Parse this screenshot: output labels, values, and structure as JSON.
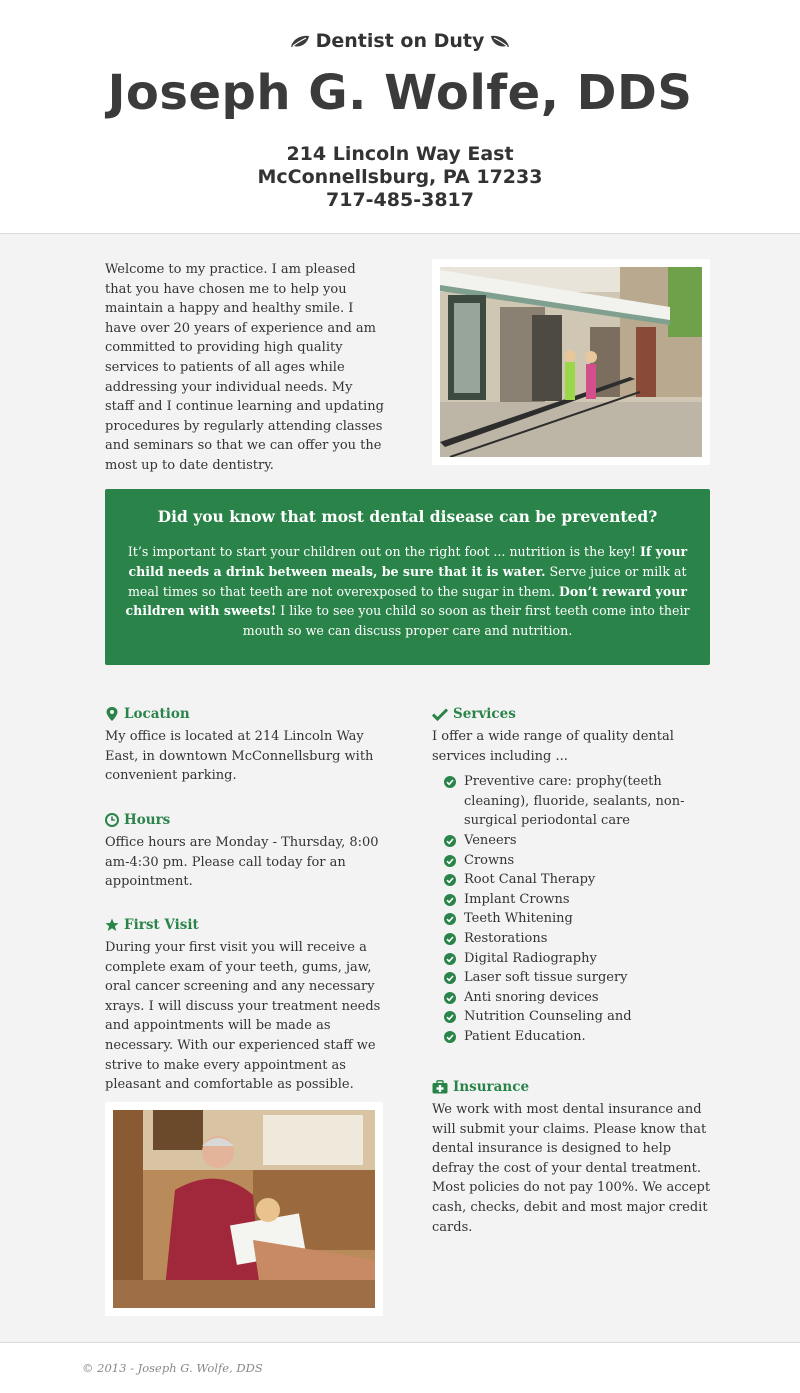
{
  "header": {
    "tagline": "Dentist on Duty",
    "name": "Joseph G. Wolfe, DDS",
    "address_line1": "214 Lincoln Way East",
    "address_line2": "McConnellsburg, PA 17233",
    "phone": "717-485-3817",
    "leaf_icon": "leaf-icon"
  },
  "welcome": {
    "text": "Welcome to my practice. I am pleased that you have chosen me to help you maintain a happy and healthy smile. I have over 20 years of experience and am committed to providing high quality services to patients of all ages while addressing your individual needs. My staff and I continue learning and updating procedures by regularly attending classes and seminars so that we can offer you the most up to date dentistry."
  },
  "callout": {
    "heading": "Did you know that most dental disease can be prevented?",
    "p1": "It’s important to start your children out on the right foot ... nutrition is the key! ",
    "b1": "If your child needs a drink between meals, be sure that it is water.",
    "p2": " Serve juice or milk at meal times so that teeth are not overexposed to the sugar in them. ",
    "b2": "Don’t reward your children with sweets!",
    "p3": " I like to see you child so soon as their first teeth come into their mouth so we can discuss proper care and nutrition.",
    "background_color": "#2a844a"
  },
  "location": {
    "title": "Location",
    "icon": "map-marker-icon",
    "text": "My office is located at 214 Lincoln Way East, in downtown McConnellsburg with convenient parking."
  },
  "hours": {
    "title": "Hours",
    "icon": "clock-icon",
    "text": "Office hours are Monday - Thursday, 8:00 am-4:30 pm. Please call today for an appointment."
  },
  "first_visit": {
    "title": "First Visit",
    "icon": "star-icon",
    "text": "During your first visit you will receive a complete exam of your teeth, gums, jaw, oral cancer screening and any necessary xrays. I will discuss your treatment needs and appointments will be made as necessary. With our experienced staff we strive to make every appointment as pleasant and comfortable as possible."
  },
  "services": {
    "title": "Services",
    "icon": "check-icon",
    "intro": "I offer a wide range of quality dental services including ...",
    "items": [
      "Preventive care: prophy(teeth cleaning), fluoride, sealants, non-surgical periodontal care",
      "Veneers",
      "Crowns",
      "Root Canal Therapy",
      "Implant Crowns",
      "Teeth Whitening",
      "Restorations",
      "Digital Radiography",
      "Laser soft tissue surgery",
      "Anti snoring devices",
      "Nutrition Counseling and",
      "Patient Education."
    ]
  },
  "insurance": {
    "title": "Insurance",
    "icon": "medkit-icon",
    "text": "We work with most dental insurance and will submit your claims. Please know that dental insurance is designed to help defray the cost of your dental treatment. Most policies do not pay 100%. We accept cash, checks, debit and most major credit cards."
  },
  "footer": {
    "copyright": "© 2013 - Joseph G. Wolfe, DDS"
  },
  "colors": {
    "accent": "#2a844a",
    "text": "#333333",
    "background": "#f3f3f3"
  }
}
